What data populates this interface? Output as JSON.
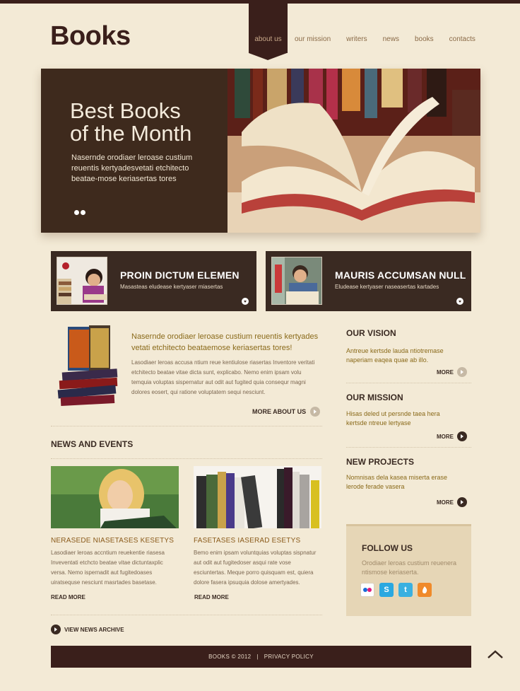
{
  "brand": {
    "logo_text": "Books"
  },
  "nav": [
    {
      "label": "about us"
    },
    {
      "label": "our mission"
    },
    {
      "label": "writers"
    },
    {
      "label": "news"
    },
    {
      "label": "books"
    },
    {
      "label": "contacts"
    }
  ],
  "slider": {
    "title_line1": "Best Books",
    "title_line2": "of the Month",
    "text": "Nasernde orodiaer leroase custium reuentis kertyadesvetati etchitecto beatae-mose keriasertas tores"
  },
  "promos": [
    {
      "title": "PROIN DICTUM ELEMEN",
      "subtitle": "Masasteas eludease kertyaser miasertas"
    },
    {
      "title": "MAURIS ACCUMSAN NULL",
      "subtitle": "Eludease kertyaser naseasertas kartades"
    }
  ],
  "about": {
    "lead": "Nasernde orodiaer leroase custium reuentis kertyades vetati etchitecto beataemose keriasertas tores!",
    "text": "Lasodiaer leroas accusa ntium reue kentiulose riasertas Inventore veritati etchitecto beatae vitae dicta sunt, explicabo. Nemo enim ipsam volu temquia voluptas sispernatur aut odit aut fugited quia consequr magni dolores eosert, qui ratione voluptatem sequi nesciunt.",
    "more_label": "MORE ABOUT US"
  },
  "news": {
    "heading": "NEWS AND EVENTS",
    "items": [
      {
        "title": "NERASEDE NIASETASES KESETYS",
        "text": "Lasodiaer leroas accntium reuekentie riasesa Inveventati etchcto beatae vitae dictuntaxplic versa. Nemo ispernadit aut fugitedoases uiratsequse nesciunt masrtades basetase.",
        "read_more": "READ MORE"
      },
      {
        "title": "FASETASES IASERAD ESETYS",
        "text": "Bemo enim ipsam voluntquias voluptas sispnatur aut odit aut fugitedoser asqui rate vose esciuntertas. Meque porro quisquam est, quiera dolore fasera ipsuquia dolose amertyades.",
        "read_more": "READ MORE"
      }
    ],
    "archive_label": "VIEW NEWS ARCHIVE"
  },
  "sidebar": {
    "vision": {
      "title": "OUR VISION",
      "text": "Antreue kertsde lauda ntiotremase naperiam eaqea quae ab illo.",
      "more": "MORE"
    },
    "mission": {
      "title": "OUR MISSION",
      "text": "Hisas deled ut persnde taea hera kertsde ntreue lertyase",
      "more": "MORE"
    },
    "projects": {
      "title": "NEW PROJECTS",
      "text": "Nomnisas dela kasea miserta erase lerode ferade vasera",
      "more": "MORE"
    }
  },
  "follow": {
    "title": "FOLLOW US",
    "text": "Orodiaer leroas custium reuenera ntismose keriaserta."
  },
  "footer": {
    "copyright": "BOOKS © 2012",
    "separator": "|",
    "privacy": "PRIVACY POLICY"
  },
  "colors": {
    "accent_dark": "#3a1f1b",
    "background": "#f3ead6",
    "gold_text": "#8a6a1a"
  }
}
